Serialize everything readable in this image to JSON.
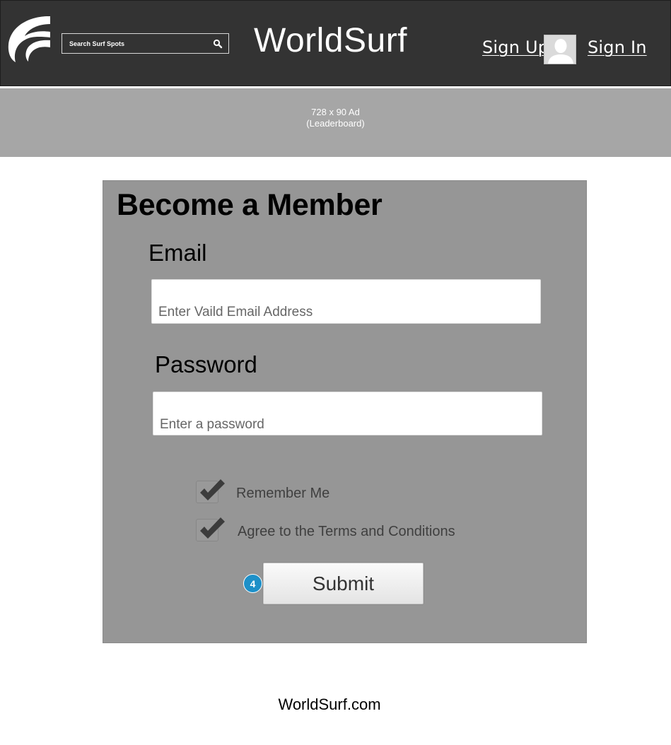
{
  "header": {
    "brand": "WorldSurf",
    "search": {
      "placeholder": "Search Surf Spots"
    },
    "nav": {
      "sign_up": "Sign Up",
      "sign_in": "Sign In"
    },
    "icons": {
      "logo": "wave-logo-icon",
      "search": "search-icon",
      "avatar": "user-avatar-icon"
    }
  },
  "ad": {
    "line1": "728 x 90 Ad",
    "line2": "(Leaderboard)"
  },
  "form": {
    "title": "Become a Member",
    "email": {
      "label": "Email",
      "placeholder": "Enter Vaild Email Address"
    },
    "password": {
      "label": "Password",
      "placeholder": "Enter a password"
    },
    "checkboxes": [
      {
        "label": "Remember Me",
        "checked": true
      },
      {
        "label": "Agree to the Terms and Conditions",
        "checked": true
      }
    ],
    "step_badge": "4",
    "submit_label": "Submit"
  },
  "footer": {
    "text": "WorldSurf.com"
  },
  "colors": {
    "header_bg": "#333333",
    "ad_bg": "#a6a6a6",
    "panel_bg": "#969696",
    "badge_bg": "#1e90c8"
  }
}
